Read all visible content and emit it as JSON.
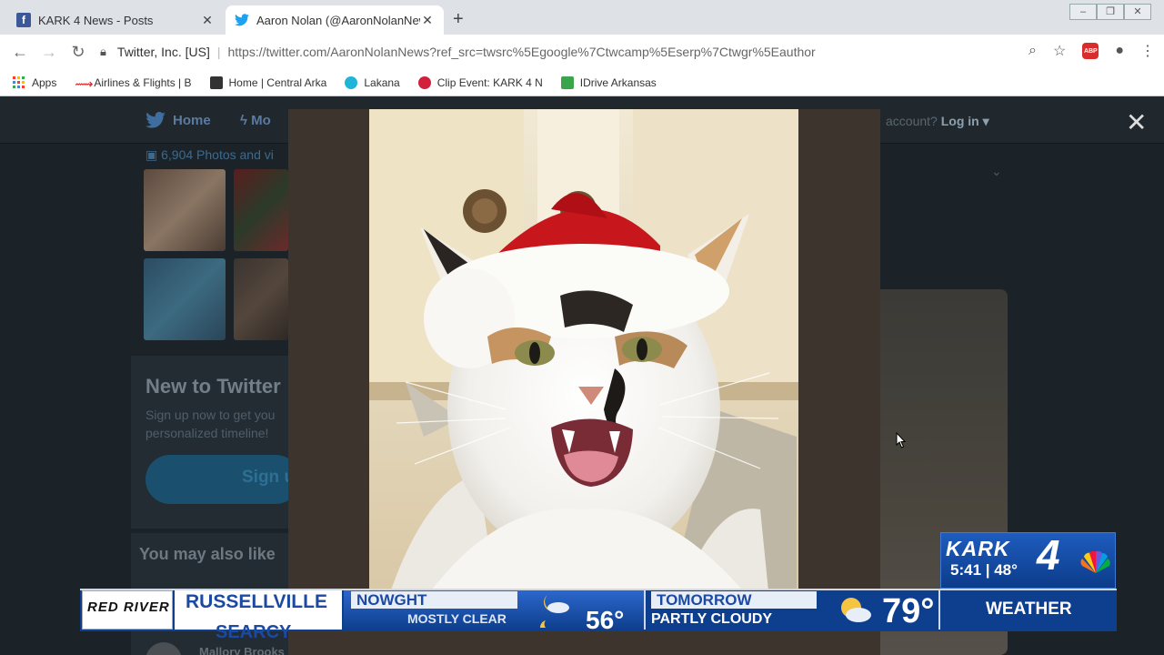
{
  "browser": {
    "tabs": [
      {
        "title": "KARK 4 News - Posts",
        "icon": "facebook-icon",
        "active": false
      },
      {
        "title": "Aaron Nolan (@AaronNolanNew",
        "icon": "twitter-icon",
        "active": true
      }
    ],
    "site_identity": "Twitter, Inc. [US]",
    "url": "https://twitter.com/AaronNolanNews?ref_src=twsrc%5Egoogle%7Ctwcamp%5Eserp%7Ctwgr%5Eauthor",
    "bookmarks": [
      {
        "label": "Apps",
        "icon": "apps-grid-icon"
      },
      {
        "label": "Airlines & Flights | B",
        "icon": "airline-icon"
      },
      {
        "label": "Home | Central Arka",
        "icon": "home-icon"
      },
      {
        "label": "Lakana",
        "icon": "lakana-icon"
      },
      {
        "label": "Clip Event: KARK 4 N",
        "icon": "clip-icon"
      },
      {
        "label": "IDrive Arkansas",
        "icon": "idrive-icon"
      }
    ],
    "abp_label": "ABP"
  },
  "twitter_page": {
    "nav_home": "Home",
    "nav_moments": "Mo",
    "login_prompt": "account?",
    "login_label": "Log in",
    "photos_link": "6,904 Photos and vi",
    "new_title": "New to Twitter",
    "new_subtitle": "Sign up now to get you personalized timeline!",
    "signup_label": "Sign u",
    "also_like": "You may also like",
    "suggested_user": "Mallory Brooks"
  },
  "lower_third": {
    "station": "KARK",
    "channel": "4",
    "time_temp": "5:41 | 48°",
    "sponsor": "RED RIVER",
    "city": "RUSSELLVILLE",
    "city_next": "SEARCY",
    "now_label": "NOWGHT",
    "now_condition": "MOSTLY CLEAR",
    "now_temp": "56°",
    "tomorrow_label": "TOMORROW",
    "tomorrow_condition": "PARTLY CLOUDY",
    "tomorrow_temp": "79°",
    "section": "WEATHER"
  },
  "colors": {
    "twitter_blue": "#1da1f2",
    "kark_blue": "#0e3f8e",
    "santa_red": "#c8161d"
  }
}
